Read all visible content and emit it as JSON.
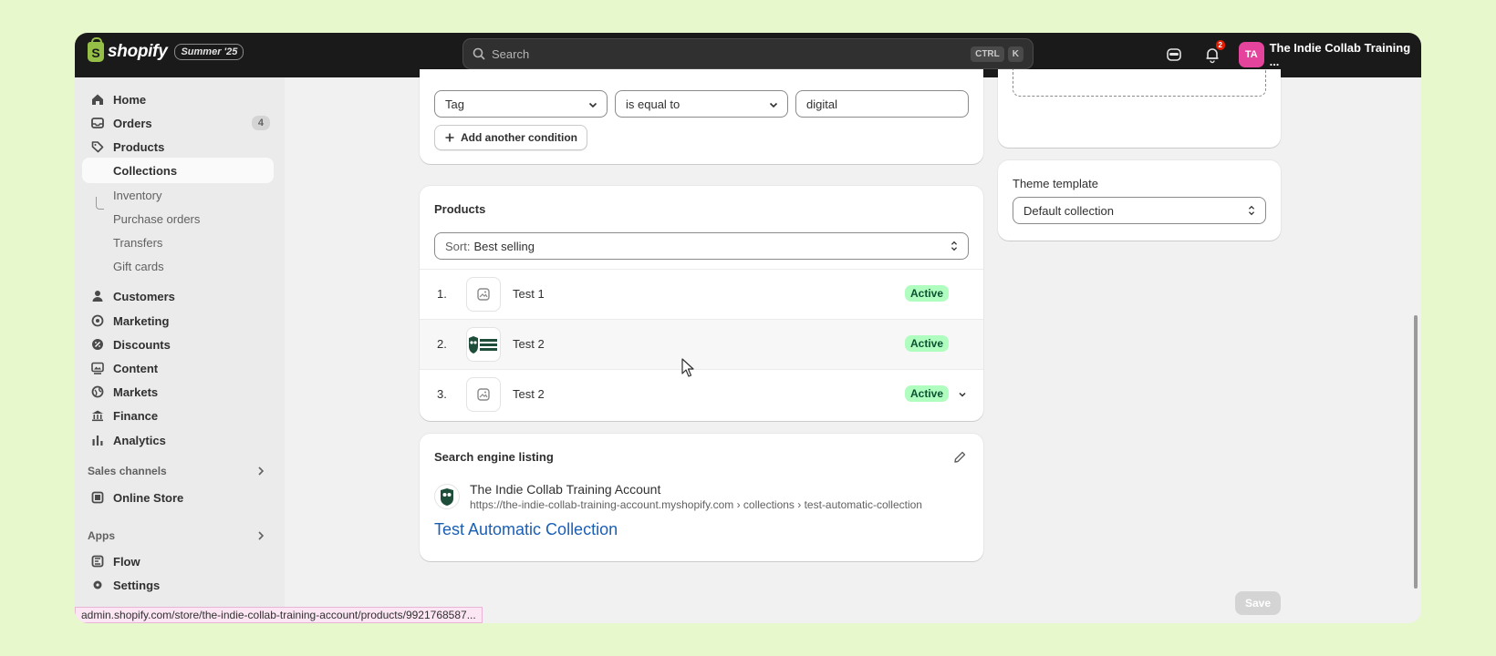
{
  "topbar": {
    "brand": "shopify",
    "version_badge": "Summer '25",
    "search_placeholder": "Search",
    "shortcut_keys": [
      "CTRL",
      "K"
    ],
    "notification_count": "2",
    "account_initials": "TA",
    "account_name": "The Indie Collab Training ..."
  },
  "sidebar": {
    "items": [
      {
        "label": "Home",
        "icon": "home-icon"
      },
      {
        "label": "Orders",
        "icon": "inbox-icon",
        "count": "4"
      },
      {
        "label": "Products",
        "icon": "tag-icon"
      },
      {
        "label": "Collections"
      },
      {
        "label": "Inventory"
      },
      {
        "label": "Purchase orders"
      },
      {
        "label": "Transfers"
      },
      {
        "label": "Gift cards"
      },
      {
        "label": "Customers",
        "icon": "person-icon"
      },
      {
        "label": "Marketing",
        "icon": "target-icon"
      },
      {
        "label": "Discounts",
        "icon": "discount-icon"
      },
      {
        "label": "Content",
        "icon": "content-icon"
      },
      {
        "label": "Markets",
        "icon": "globe-icon"
      },
      {
        "label": "Finance",
        "icon": "bank-icon"
      },
      {
        "label": "Analytics",
        "icon": "chart-icon"
      }
    ],
    "sales_channels_label": "Sales channels",
    "online_store": "Online Store",
    "apps_label": "Apps",
    "flow": "Flow",
    "settings": "Settings"
  },
  "conditions": {
    "field": "Tag",
    "operator": "is equal to",
    "value": "digital",
    "add_condition": "Add another condition"
  },
  "products": {
    "title": "Products",
    "sort_prefix": "Sort:",
    "sort_value": "Best selling",
    "rows": [
      {
        "num": "1.",
        "name": "Test 1",
        "status": "Active"
      },
      {
        "num": "2.",
        "name": "Test 2",
        "status": "Active"
      },
      {
        "num": "3.",
        "name": "Test 2",
        "status": "Active"
      }
    ]
  },
  "seo": {
    "title": "Search engine listing",
    "site_name": "The Indie Collab Training Account",
    "url": "https://the-indie-collab-training-account.myshopify.com › collections › test-automatic-collection",
    "page_title": "Test Automatic Collection"
  },
  "theme": {
    "label": "Theme template",
    "value": "Default collection"
  },
  "save_label": "Save",
  "status_url": "admin.shopify.com/store/the-indie-collab-training-account/products/9921768587...",
  "colors": {
    "topbar": "#1a1a1a",
    "brand_green": "#95bf47",
    "avatar": "#e4449b",
    "active_badge_bg": "#affebf",
    "active_badge_text": "#0c5132",
    "link_blue": "#1a5fb4"
  }
}
